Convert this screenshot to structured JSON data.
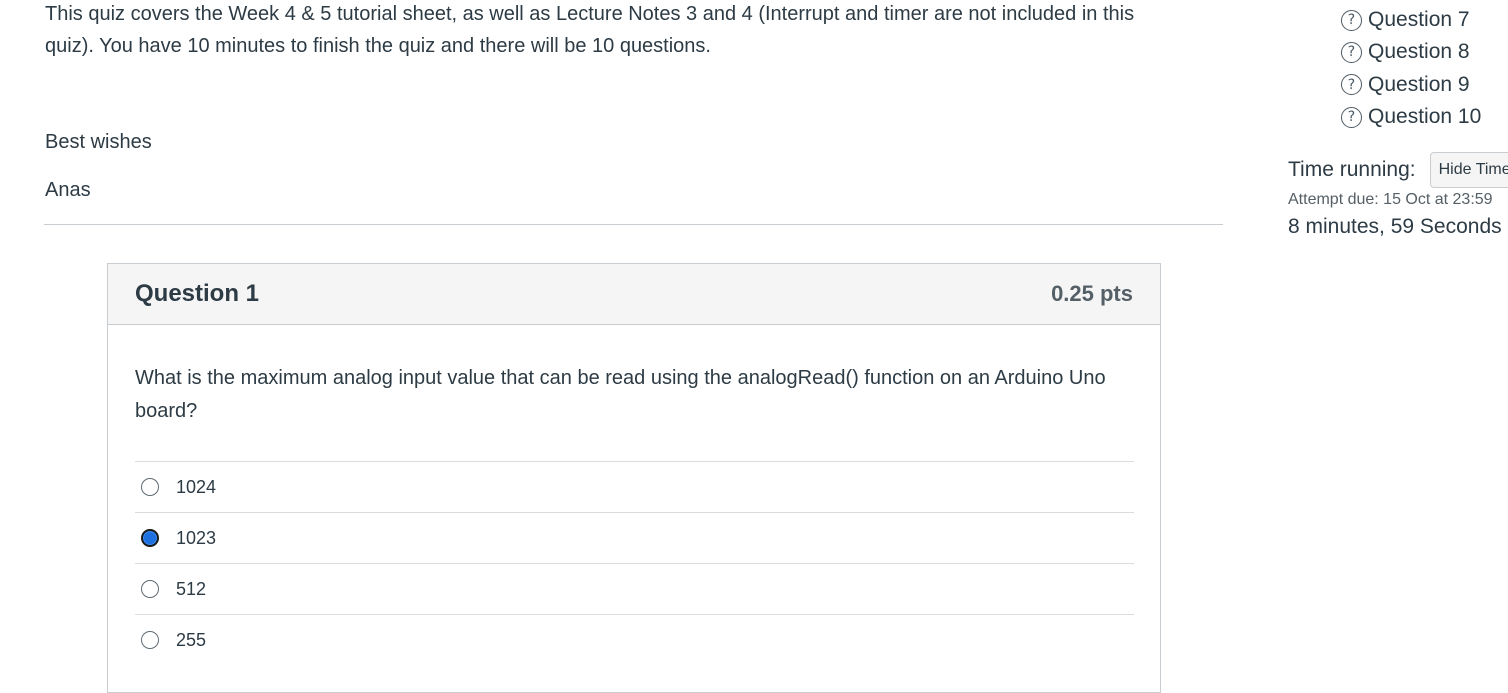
{
  "intro": {
    "line1": "This quiz covers the Week 4 & 5 tutorial sheet, as well as Lecture Notes 3 and 4 (Interrupt and timer are not included in this",
    "line2": "quiz). You have 10 minutes to finish the quiz and there will be 10 questions.",
    "greeting": "Best wishes",
    "signature": "Anas"
  },
  "question": {
    "title": "Question 1",
    "points": "0.25 pts",
    "text": "What is the maximum analog input value that can be read using the analogRead() function on an Arduino Uno board?",
    "answers": [
      {
        "label": "1024",
        "selected": false
      },
      {
        "label": "1023",
        "selected": true
      },
      {
        "label": "512",
        "selected": false
      },
      {
        "label": "255",
        "selected": false
      }
    ]
  },
  "sidebar": {
    "question_icon": "question-circle-icon",
    "questions": [
      "Question 7",
      "Question 8",
      "Question 9",
      "Question 10"
    ],
    "time_running_label": "Time running:",
    "hide_timer_label": "Hide Timer",
    "attempt_due": "Attempt due: 15 Oct at 23:59",
    "time_remaining": "8 minutes, 59 Seconds"
  },
  "colors": {
    "text": "#2d3b45",
    "selected_radio": "#1e6fdf",
    "border": "#c7cdd1",
    "header_bg": "#f5f5f5"
  }
}
